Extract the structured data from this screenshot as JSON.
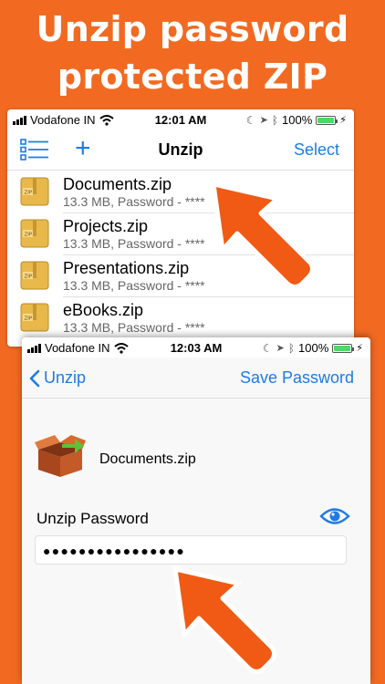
{
  "headline": {
    "line1": "Unzip password",
    "line2": "protected ZIP"
  },
  "colors": {
    "background": "#F26A22",
    "accent": "#1E7BE6",
    "arrow": "#F05A14"
  },
  "screen1": {
    "status": {
      "carrier": "Vodafone IN",
      "time": "12:01 AM",
      "battery": "100%"
    },
    "nav": {
      "title": "Unzip",
      "select_label": "Select",
      "list_icon": "list-icon",
      "add_icon": "plus-icon"
    },
    "files": [
      {
        "name": "Documents.zip",
        "meta": "13.3 MB, Password - ****"
      },
      {
        "name": "Projects.zip",
        "meta": "13.3 MB, Password - ****"
      },
      {
        "name": "Presentations.zip",
        "meta": "13.3 MB, Password - ****"
      },
      {
        "name": "eBooks.zip",
        "meta": "13.3 MB, Password - ****"
      }
    ]
  },
  "screen2": {
    "status": {
      "carrier": "Vodafone IN",
      "time": "12:03 AM",
      "battery": "100%"
    },
    "nav": {
      "back_label": "Unzip",
      "save_label": "Save Password"
    },
    "file_name": "Documents.zip",
    "password_label": "Unzip Password",
    "password_value": "●●●●●●●●●●●●●●●●"
  }
}
